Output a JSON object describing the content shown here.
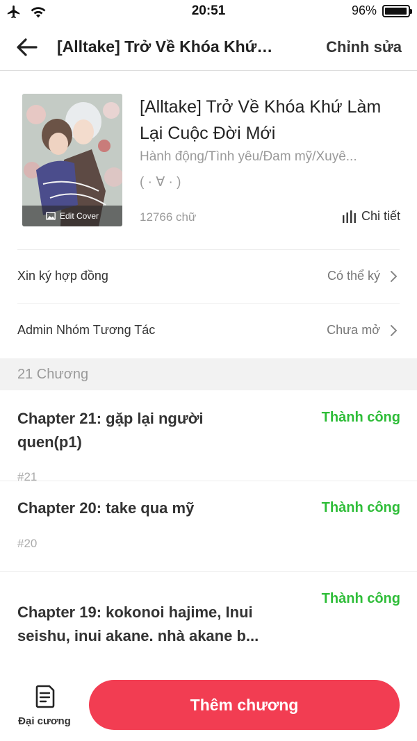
{
  "status_bar": {
    "time": "20:51",
    "battery_text": "96%",
    "battery_level": 0.96,
    "icons": [
      "airplane-icon",
      "wifi-icon",
      "battery-icon"
    ]
  },
  "nav": {
    "back_icon": "arrow-left-icon",
    "title": "[Alltake] Trở Về Khóa Khứ…",
    "edit_label": "Chỉnh sửa"
  },
  "book": {
    "cover_edit_label": "Edit Cover",
    "title": "[Alltake] Trở Về Khóa Khứ Làm Lại Cuộc Đời Mới",
    "genres": "Hành động/Tình yêu/Đam mỹ/Xuyê...",
    "face": "( · ∀ · )",
    "word_count": "12766 chữ",
    "detail_label": "Chi tiết"
  },
  "settings": [
    {
      "label": "Xin ký hợp đồng",
      "value": "Có thể ký"
    },
    {
      "label": "Admin Nhóm Tương Tác",
      "value": "Chưa mở"
    }
  ],
  "chapters_header": "21 Chương",
  "chapters": [
    {
      "title": "Chapter 21: gặp lại người quen(p1)",
      "status": "Thành công",
      "number": "#21"
    },
    {
      "title": "Chapter 20: take qua mỹ",
      "status": "Thành công",
      "number": "#20"
    },
    {
      "title": "Chapter 19: kokonoi hajime, Inui seishu, inui akane. nhà akane b...",
      "status": "Thành công",
      "number": ""
    }
  ],
  "bottom": {
    "outline_label": "Đại cương",
    "add_chapter_label": "Thêm chương"
  },
  "colors": {
    "accent": "#f23d52",
    "success": "#2ebd38"
  }
}
